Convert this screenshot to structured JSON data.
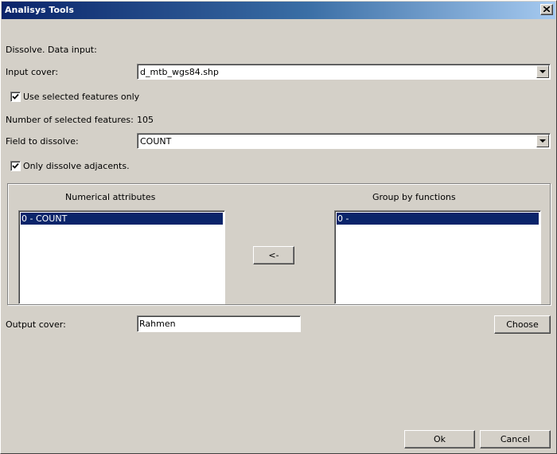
{
  "window": {
    "title": "Analisys Tools"
  },
  "form": {
    "section_label": "Dissolve. Data input:",
    "input_cover_label": "Input cover:",
    "input_cover_value": "d_mtb_wgs84.shp",
    "use_selected_label": "Use selected features only",
    "use_selected_checked": true,
    "num_selected_label": "Number of selected features:",
    "num_selected_value": "105",
    "field_dissolve_label": "Field to dissolve:",
    "field_dissolve_value": "COUNT",
    "only_adjacents_label": "Only dissolve adjacents.",
    "only_adjacents_checked": true
  },
  "lists": {
    "numerical_header": "Numerical attributes",
    "numerical_items": [
      "0 - COUNT"
    ],
    "group_header": "Group by functions",
    "group_items": [
      "0 -"
    ],
    "move_left_label": "<-"
  },
  "output": {
    "label": "Output cover:",
    "value": "Rahmen",
    "choose_label": "Choose"
  },
  "footer": {
    "ok_label": "Ok",
    "cancel_label": "Cancel"
  },
  "colors": {
    "dialog_bg": "#d4d0c8",
    "title_gradient_start": "#0a246a",
    "title_gradient_end": "#a6caf0",
    "selection": "#0a246a"
  },
  "icons": {
    "close": "close-icon",
    "combo_arrow": "chevron-down-icon",
    "checkmark": "checkmark-icon"
  }
}
